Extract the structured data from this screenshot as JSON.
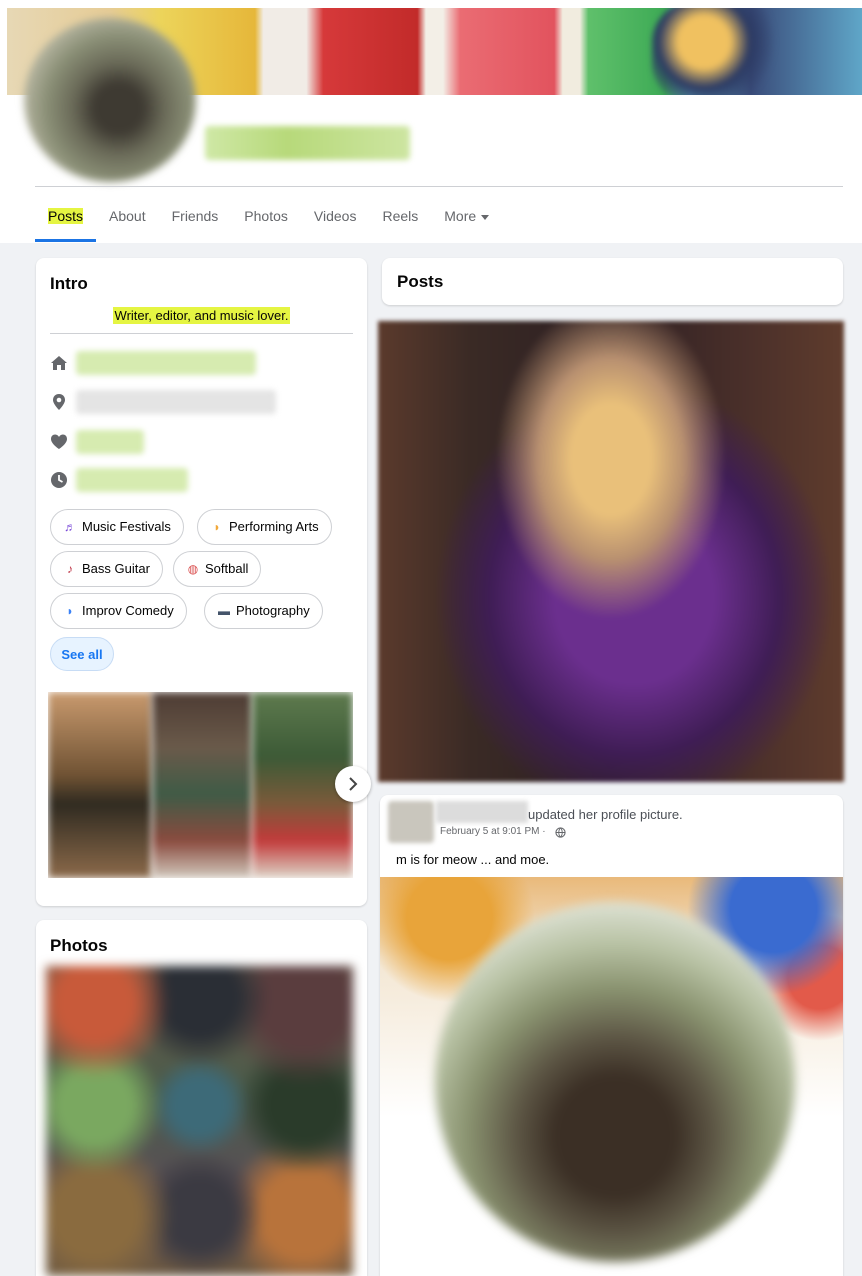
{
  "tabs": [
    {
      "label": "Posts"
    },
    {
      "label": "About"
    },
    {
      "label": "Friends"
    },
    {
      "label": "Photos"
    },
    {
      "label": "Videos"
    },
    {
      "label": "Reels"
    },
    {
      "label": "More"
    }
  ],
  "intro": {
    "title": "Intro",
    "bio": "Writer, editor, and music lover.",
    "detail_icons": [
      "home-icon",
      "location-pin-icon",
      "heart-icon",
      "clock-icon"
    ],
    "hobbies": [
      {
        "label": "Music Festivals",
        "icon": "music-festival-icon"
      },
      {
        "label": "Performing Arts",
        "icon": "theater-masks-icon"
      },
      {
        "label": "Bass Guitar",
        "icon": "guitar-icon"
      },
      {
        "label": "Softball",
        "icon": "softball-icon"
      },
      {
        "label": "Improv Comedy",
        "icon": "theater-masks-icon"
      },
      {
        "label": "Photography",
        "icon": "camera-icon"
      }
    ],
    "see_all": "See all"
  },
  "photos": {
    "title": "Photos"
  },
  "posts": {
    "title": "Posts",
    "post": {
      "action": "updated her profile picture.",
      "time": "February 5 at 9:01 PM ·",
      "text": "m is for meow ... and moe."
    }
  },
  "colors": {
    "highlight": "#e5f542",
    "accent": "#1b74e4",
    "page_bg": "#f0f2f5"
  }
}
